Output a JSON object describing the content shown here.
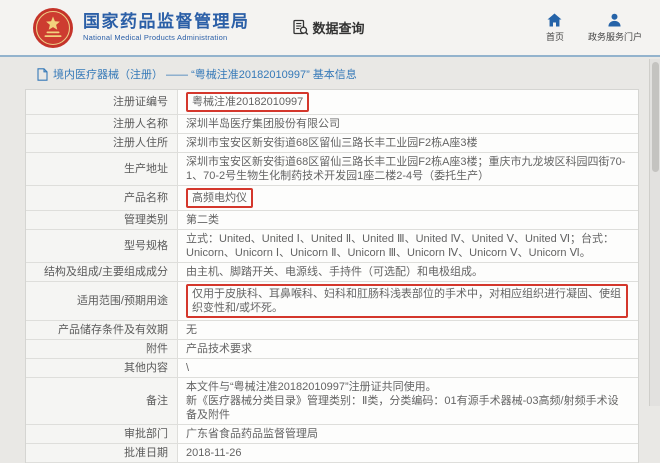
{
  "header": {
    "agency_name": "国家药品监督管理局",
    "agency_name_en": "National Medical Products Administration",
    "data_query_label": "数据查询",
    "home_label": "首页",
    "portal_label": "政务服务门户"
  },
  "breadcrumb": {
    "text": "境内医疗器械（注册） —— “粤械注准20182010997” 基本信息"
  },
  "table": {
    "rows": [
      {
        "label": "注册证编号",
        "value": "粤械注准20182010997",
        "highlight": true
      },
      {
        "label": "注册人名称",
        "value": "深圳半岛医疗集团股份有限公司",
        "highlight": false
      },
      {
        "label": "注册人住所",
        "value": "深圳市宝安区新安街道68区留仙三路长丰工业园F2栋A座3楼",
        "highlight": false
      },
      {
        "label": "生产地址",
        "value": "深圳市宝安区新安街道68区留仙三路长丰工业园F2栋A座3楼；重庆市九龙坡区科园四街70-1、70-2号生物生化制药技术开发园1座二楼2-4号（委托生产）",
        "highlight": false
      },
      {
        "label": "产品名称",
        "value": "高频电灼仪",
        "highlight": true
      },
      {
        "label": "管理类别",
        "value": "第二类",
        "highlight": false
      },
      {
        "label": "型号规格",
        "value": "立式：United、United Ⅰ、United Ⅱ、United Ⅲ、United Ⅳ、United Ⅴ、United Ⅵ；台式：Unicorn、Unicorn Ⅰ、Unicorn Ⅱ、Unicorn Ⅲ、Unicorn Ⅳ、Unicorn Ⅴ、Unicorn Ⅵ。",
        "highlight": false
      },
      {
        "label": "结构及组成/主要组成成分",
        "value": "由主机、脚踏开关、电源线、手持件（可选配）和电极组成。",
        "highlight": false
      },
      {
        "label": "适用范围/预期用途",
        "value": "仅用于皮肤科、耳鼻喉科、妇科和肛肠科浅表部位的手术中，对相应组织进行凝固、使组织变性和/或坏死。",
        "highlight": true
      },
      {
        "label": "产品储存条件及有效期",
        "value": "无",
        "highlight": false
      },
      {
        "label": "附件",
        "value": "产品技术要求",
        "highlight": false
      },
      {
        "label": "其他内容",
        "value": "\\",
        "highlight": false
      },
      {
        "label": "备注",
        "value": "本文件与“粤械注准20182010997”注册证共同使用。\n新《医疗器械分类目录》管理类别：Ⅱ类，分类编码：01有源手术器械-03高频/射频手术设备及附件",
        "highlight": false
      },
      {
        "label": "审批部门",
        "value": "广东省食品药品监督管理局",
        "highlight": false
      },
      {
        "label": "批准日期",
        "value": "2018-11-26",
        "highlight": false
      }
    ]
  },
  "colors": {
    "accent_blue": "#2b5fa7",
    "link_blue": "#3579b8",
    "highlight_red": "#d4372c",
    "emblem_red": "#c5332a"
  }
}
